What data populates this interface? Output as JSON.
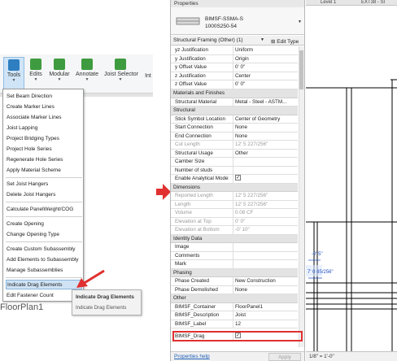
{
  "ribbon": {
    "buttons": [
      {
        "label": "Tools",
        "icon": "tools-icon",
        "color": "#2e7fc1"
      },
      {
        "label": "Edits",
        "icon": "edits-icon",
        "color": "#3f9b3f"
      },
      {
        "label": "Modular",
        "icon": "modular-icon",
        "color": "#3f9b3f"
      },
      {
        "label": "Annotate",
        "icon": "annotate-icon",
        "color": "#3f9b3f"
      },
      {
        "label": "Joist Selector",
        "icon": "joist-selector-icon",
        "color": "#3f9b3f"
      },
      {
        "label": "Int",
        "icon": "",
        "color": ""
      }
    ]
  },
  "menu": {
    "items": [
      "Set Beam Direction",
      "Create Marker Lines",
      "Associate Marker Lines",
      "Joist Lapping",
      "Project Bridging Types",
      "Project Hole Series",
      "Regenerate Hole Series",
      "Apply Material Scheme",
      "Set Joist Hangers",
      "Delete Joist Hangers",
      "Calculate PanelWeight/COG",
      "Create Opening",
      "Change Opening Type",
      "Create Custom Subassembly",
      "Add Elements to Subassembly",
      "Manage Subassemblies",
      "Indicate Drag Elements",
      "Edit Fastener Count"
    ],
    "highlighted": "Indicate Drag Elements"
  },
  "tooltip": {
    "title": "Indicate Drag Elements",
    "description": "Indicate Drag Elements"
  },
  "floorplan_label": "FloorPlan1",
  "properties": {
    "title": "Properties",
    "type_line1": "BIMSF-SSMA-S",
    "type_line2": "1000S250-54",
    "instance": "Structural Framing (Other) (1)",
    "edit_type": "Edit Type",
    "rows": [
      {
        "k": "yz Justification",
        "v": "Uniform"
      },
      {
        "k": "y Justification",
        "v": "Origin"
      },
      {
        "k": "y Offset Value",
        "v": "0'  0\""
      },
      {
        "k": "z Justification",
        "v": "Center"
      },
      {
        "k": "z Offset Value",
        "v": "0'  0\""
      }
    ],
    "group_materials": "Materials and Finishes",
    "rows_materials": [
      {
        "k": "Structural Material",
        "v": "Metal - Steel - ASTM..."
      }
    ],
    "group_structural": "Structural",
    "rows_structural": [
      {
        "k": "Stick Symbol Location",
        "v": "Center of Geometry"
      },
      {
        "k": "Start Connection",
        "v": "None"
      },
      {
        "k": "End Connection",
        "v": "None"
      },
      {
        "k": "Cut Length",
        "v": "12'  5 227/256\""
      },
      {
        "k": "Structural Usage",
        "v": "Other"
      },
      {
        "k": "Camber Size",
        "v": ""
      },
      {
        "k": "Number of studs",
        "v": ""
      },
      {
        "k": "Enable Analytical Model",
        "v": "checked"
      }
    ],
    "group_dimensions": "Dimensions",
    "rows_dimensions": [
      {
        "k": "Reported Length",
        "v": "12'  5 227/256\""
      },
      {
        "k": "Length",
        "v": "12'  5 227/256\""
      },
      {
        "k": "Volume",
        "v": "0.08 CF"
      },
      {
        "k": "Elevation at Top",
        "v": "0'  0\""
      },
      {
        "k": "Elevation at Bottom",
        "v": "-0'  10\""
      }
    ],
    "group_identity": "Identity Data",
    "rows_identity": [
      {
        "k": "Image",
        "v": ""
      },
      {
        "k": "Comments",
        "v": ""
      },
      {
        "k": "Mark",
        "v": ""
      }
    ],
    "group_phasing": "Phasing",
    "rows_phasing": [
      {
        "k": "Phase Created",
        "v": "New Construction"
      },
      {
        "k": "Phase Demolished",
        "v": "None"
      }
    ],
    "group_other": "Other",
    "rows_other": [
      {
        "k": "BIMSF_Container",
        "v": "FloorPanel1"
      },
      {
        "k": "BIMSF_Description",
        "v": "Joist"
      },
      {
        "k": "BIMSF_Label",
        "v": "12"
      },
      {
        "k": "BIMSF_Drag",
        "v": "checked"
      }
    ],
    "help_link": "Properties help",
    "apply": "Apply"
  },
  "view": {
    "tabs": [
      "Level 1",
      "EXT38 - Sl"
    ],
    "dim1": "-0' 5\"",
    "dim2": "7' 0 85/256\"",
    "scale": "1/8\" = 1'-0\""
  },
  "colors": {
    "highlight_box": "#e03030",
    "arrow": "#e03030"
  }
}
